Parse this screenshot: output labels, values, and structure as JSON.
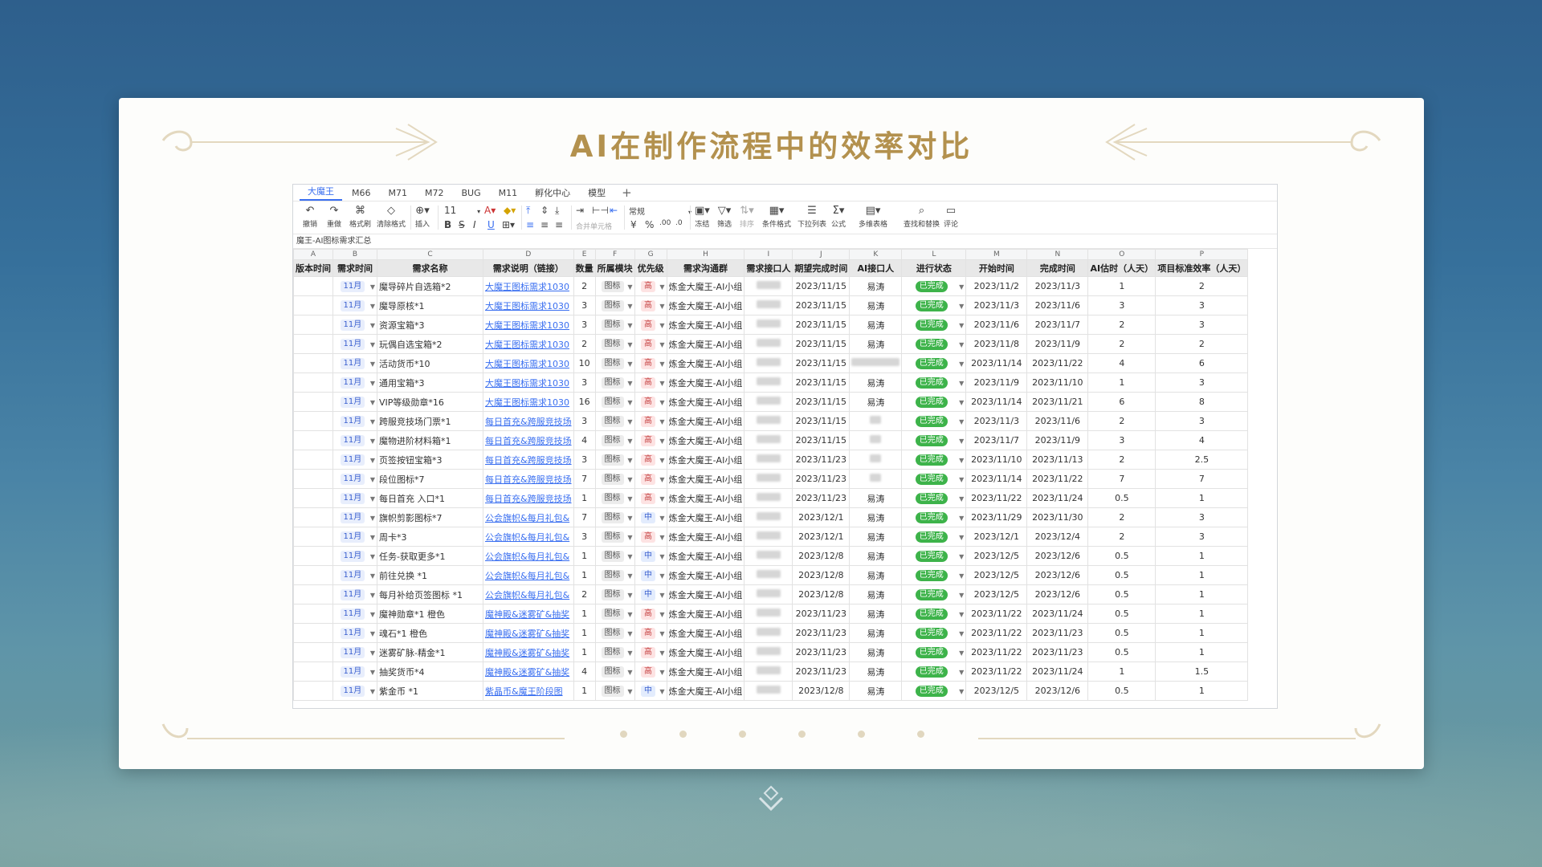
{
  "slide": {
    "title": "AI在制作流程中的效率对比",
    "accent_color": "#b3914e"
  },
  "sheet": {
    "tabs": [
      "大魔王",
      "M66",
      "M71",
      "M72",
      "BUG",
      "M11",
      "孵化中心",
      "模型"
    ],
    "active_tab": "大魔王",
    "toolbar": {
      "undo": "撤销",
      "redo": "重做",
      "format_painter": "格式刷",
      "clear_format": "清除格式",
      "insert": "插入",
      "font_size": "11",
      "number_format": "常规",
      "merge": "合并单元格",
      "freeze": "冻结",
      "filter": "筛选",
      "sort": "排序",
      "conditional": "条件格式",
      "dropdown": "下拉列表",
      "formula": "公式",
      "multi_table": "多维表格",
      "find_replace": "查找和替换",
      "comment": "评论",
      "currency": "¥",
      "percent": "%"
    },
    "formula_bar": "魔王-AI图标需求汇总",
    "column_letters": [
      "A",
      "B",
      "C",
      "D",
      "E",
      "F",
      "G",
      "H",
      "I",
      "J",
      "K",
      "L",
      "M",
      "N",
      "O",
      "P"
    ],
    "headers": [
      "版本时间",
      "需求时间",
      "需求名称",
      "需求说明（链接）",
      "数量",
      "所属模块",
      "优先级",
      "需求沟通群",
      "需求接口人",
      "期望完成时间",
      "AI接口人",
      "进行状态",
      "开始时间",
      "完成时间",
      "AI估时（人天）",
      "项目标准效率（人天）"
    ],
    "rows": [
      {
        "month": "11月",
        "name": "魔导碎片自选箱*2",
        "link": "大魔王图标需求1030",
        "qty": "2",
        "module": "图标",
        "priority": "高",
        "group": "炼金大魔王-AI小组",
        "due": "2023/11/15",
        "ai": "易涛",
        "status": "已完成",
        "start": "2023/11/2",
        "end": "2023/11/3",
        "ai_est": "1",
        "std": "2"
      },
      {
        "month": "11月",
        "name": "魔导原核*1",
        "link": "大魔王图标需求1030",
        "qty": "3",
        "module": "图标",
        "priority": "高",
        "group": "炼金大魔王-AI小组",
        "due": "2023/11/15",
        "ai": "易涛",
        "status": "已完成",
        "start": "2023/11/3",
        "end": "2023/11/6",
        "ai_est": "3",
        "std": "3"
      },
      {
        "month": "11月",
        "name": "资源宝箱*3",
        "link": "大魔王图标需求1030",
        "qty": "3",
        "module": "图标",
        "priority": "高",
        "group": "炼金大魔王-AI小组",
        "due": "2023/11/15",
        "ai": "易涛",
        "status": "已完成",
        "start": "2023/11/6",
        "end": "2023/11/7",
        "ai_est": "2",
        "std": "3"
      },
      {
        "month": "11月",
        "name": "玩偶自选宝箱*2",
        "link": "大魔王图标需求1030",
        "qty": "2",
        "module": "图标",
        "priority": "高",
        "group": "炼金大魔王-AI小组",
        "due": "2023/11/15",
        "ai": "易涛",
        "status": "已完成",
        "start": "2023/11/8",
        "end": "2023/11/9",
        "ai_est": "2",
        "std": "2"
      },
      {
        "month": "11月",
        "name": "活动货币*10",
        "link": "大魔王图标需求1030",
        "qty": "10",
        "module": "图标",
        "priority": "高",
        "group": "炼金大魔王-AI小组",
        "due": "2023/11/15",
        "ai": "",
        "status": "已完成",
        "start": "2023/11/14",
        "end": "2023/11/22",
        "ai_est": "4",
        "std": "6"
      },
      {
        "month": "11月",
        "name": "通用宝箱*3",
        "link": "大魔王图标需求1030",
        "qty": "3",
        "module": "图标",
        "priority": "高",
        "group": "炼金大魔王-AI小组",
        "due": "2023/11/15",
        "ai": "易涛",
        "status": "已完成",
        "start": "2023/11/9",
        "end": "2023/11/10",
        "ai_est": "1",
        "std": "3"
      },
      {
        "month": "11月",
        "name": "VIP等级勋章*16",
        "link": "大魔王图标需求1030",
        "qty": "16",
        "module": "图标",
        "priority": "高",
        "group": "炼金大魔王-AI小组",
        "due": "2023/11/15",
        "ai": "易涛",
        "status": "已完成",
        "start": "2023/11/14",
        "end": "2023/11/21",
        "ai_est": "6",
        "std": "8"
      },
      {
        "month": "11月",
        "name": "跨服竞技场门票*1",
        "link": "每日首充&跨服竞技场",
        "qty": "3",
        "module": "图标",
        "priority": "高",
        "group": "炼金大魔王-AI小组",
        "due": "2023/11/15",
        "ai": "",
        "status": "已完成",
        "start": "2023/11/3",
        "end": "2023/11/6",
        "ai_est": "2",
        "std": "3"
      },
      {
        "month": "11月",
        "name": "魔物进阶材料箱*1",
        "link": "每日首充&跨服竞技场",
        "qty": "4",
        "module": "图标",
        "priority": "高",
        "group": "炼金大魔王-AI小组",
        "due": "2023/11/15",
        "ai": "",
        "status": "已完成",
        "start": "2023/11/7",
        "end": "2023/11/9",
        "ai_est": "3",
        "std": "4"
      },
      {
        "month": "11月",
        "name": "页签按钮宝箱*3",
        "link": "每日首充&跨服竞技场",
        "qty": "3",
        "module": "图标",
        "priority": "高",
        "group": "炼金大魔王-AI小组",
        "due": "2023/11/23",
        "ai": "",
        "status": "已完成",
        "start": "2023/11/10",
        "end": "2023/11/13",
        "ai_est": "2",
        "std": "2.5"
      },
      {
        "month": "11月",
        "name": "段位图标*7",
        "link": "每日首充&跨服竞技场",
        "qty": "7",
        "module": "图标",
        "priority": "高",
        "group": "炼金大魔王-AI小组",
        "due": "2023/11/23",
        "ai": "",
        "status": "已完成",
        "start": "2023/11/14",
        "end": "2023/11/22",
        "ai_est": "7",
        "std": "7"
      },
      {
        "month": "11月",
        "name": "每日首充 入口*1",
        "link": "每日首充&跨服竞技场",
        "qty": "1",
        "module": "图标",
        "priority": "高",
        "group": "炼金大魔王-AI小组",
        "due": "2023/11/23",
        "ai": "易涛",
        "status": "已完成",
        "start": "2023/11/22",
        "end": "2023/11/24",
        "ai_est": "0.5",
        "std": "1"
      },
      {
        "month": "11月",
        "name": "旗帜剪影图标*7",
        "link": "公会旗帜&每月礼包&",
        "qty": "7",
        "module": "图标",
        "priority": "中",
        "group": "炼金大魔王-AI小组",
        "due": "2023/12/1",
        "ai": "易涛",
        "status": "已完成",
        "start": "2023/11/29",
        "end": "2023/11/30",
        "ai_est": "2",
        "std": "3"
      },
      {
        "month": "11月",
        "name": "周卡*3",
        "link": "公会旗帜&每月礼包&",
        "qty": "3",
        "module": "图标",
        "priority": "高",
        "group": "炼金大魔王-AI小组",
        "due": "2023/12/1",
        "ai": "易涛",
        "status": "已完成",
        "start": "2023/12/1",
        "end": "2023/12/4",
        "ai_est": "2",
        "std": "3"
      },
      {
        "month": "11月",
        "name": "任务-获取更多*1",
        "link": "公会旗帜&每月礼包&",
        "qty": "1",
        "module": "图标",
        "priority": "中",
        "group": "炼金大魔王-AI小组",
        "due": "2023/12/8",
        "ai": "易涛",
        "status": "已完成",
        "start": "2023/12/5",
        "end": "2023/12/6",
        "ai_est": "0.5",
        "std": "1"
      },
      {
        "month": "11月",
        "name": "前往兑换 *1",
        "link": "公会旗帜&每月礼包&",
        "qty": "1",
        "module": "图标",
        "priority": "中",
        "group": "炼金大魔王-AI小组",
        "due": "2023/12/8",
        "ai": "易涛",
        "status": "已完成",
        "start": "2023/12/5",
        "end": "2023/12/6",
        "ai_est": "0.5",
        "std": "1"
      },
      {
        "month": "11月",
        "name": "每月补给页签图标 *1",
        "link": "公会旗帜&每月礼包&",
        "qty": "2",
        "module": "图标",
        "priority": "中",
        "group": "炼金大魔王-AI小组",
        "due": "2023/12/8",
        "ai": "易涛",
        "status": "已完成",
        "start": "2023/12/5",
        "end": "2023/12/6",
        "ai_est": "0.5",
        "std": "1"
      },
      {
        "month": "11月",
        "name": "魔神勋章*1 橙色",
        "link": "魔神殿&迷雾矿&抽奖",
        "qty": "1",
        "module": "图标",
        "priority": "高",
        "group": "炼金大魔王-AI小组",
        "due": "2023/11/23",
        "ai": "易涛",
        "status": "已完成",
        "start": "2023/11/22",
        "end": "2023/11/24",
        "ai_est": "0.5",
        "std": "1"
      },
      {
        "month": "11月",
        "name": "魂石*1 橙色",
        "link": "魔神殿&迷雾矿&抽奖",
        "qty": "1",
        "module": "图标",
        "priority": "高",
        "group": "炼金大魔王-AI小组",
        "due": "2023/11/23",
        "ai": "易涛",
        "status": "已完成",
        "start": "2023/11/22",
        "end": "2023/11/23",
        "ai_est": "0.5",
        "std": "1"
      },
      {
        "month": "11月",
        "name": "迷雾矿脉-精金*1",
        "link": "魔神殿&迷雾矿&抽奖",
        "qty": "1",
        "module": "图标",
        "priority": "高",
        "group": "炼金大魔王-AI小组",
        "due": "2023/11/23",
        "ai": "易涛",
        "status": "已完成",
        "start": "2023/11/22",
        "end": "2023/11/23",
        "ai_est": "0.5",
        "std": "1"
      },
      {
        "month": "11月",
        "name": "抽奖货币*4",
        "link": "魔神殿&迷雾矿&抽奖",
        "qty": "4",
        "module": "图标",
        "priority": "高",
        "group": "炼金大魔王-AI小组",
        "due": "2023/11/23",
        "ai": "易涛",
        "status": "已完成",
        "start": "2023/11/22",
        "end": "2023/11/24",
        "ai_est": "1",
        "std": "1.5"
      },
      {
        "month": "11月",
        "name": "紫金币 *1",
        "link": "紫晶币&魔王阶段图",
        "qty": "1",
        "module": "图标",
        "priority": "中",
        "group": "炼金大魔王-AI小组",
        "due": "2023/12/8",
        "ai": "易涛",
        "status": "已完成",
        "start": "2023/12/5",
        "end": "2023/12/6",
        "ai_est": "0.5",
        "std": "1"
      }
    ]
  }
}
